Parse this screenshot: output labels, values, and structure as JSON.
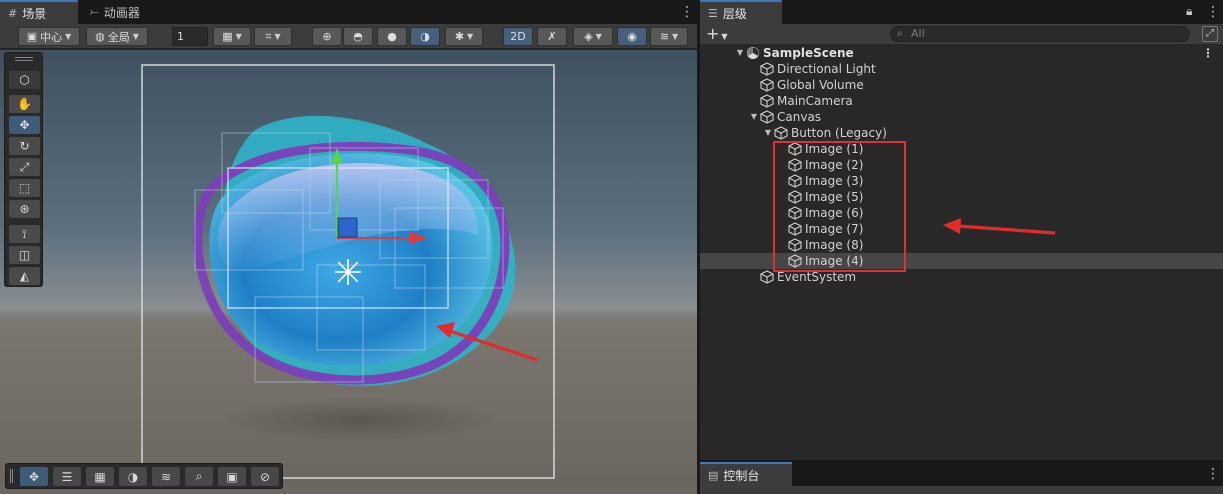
{
  "scene_panel": {
    "tabs": [
      {
        "label": "场景",
        "icon": "grid-icon"
      },
      {
        "label": "动画器",
        "icon": "animator-icon"
      }
    ],
    "toolbar": {
      "pivot_label": "中心",
      "space_label": "全局",
      "snap_value": "1",
      "mode_2d_label": "2D"
    }
  },
  "hierarchy": {
    "tab_label": "层级",
    "search_placeholder": "All",
    "add_label": "+",
    "items": [
      {
        "label": "SampleScene",
        "depth": 0,
        "expanded": true,
        "type": "scene"
      },
      {
        "label": "Directional Light",
        "depth": 1,
        "type": "object"
      },
      {
        "label": "Global Volume",
        "depth": 1,
        "type": "object"
      },
      {
        "label": "MainCamera",
        "depth": 1,
        "type": "object"
      },
      {
        "label": "Canvas",
        "depth": 1,
        "expanded": true,
        "type": "object"
      },
      {
        "label": "Button (Legacy)",
        "depth": 2,
        "expanded": true,
        "type": "object"
      },
      {
        "label": "Image (1)",
        "depth": 3,
        "type": "object"
      },
      {
        "label": "Image (2)",
        "depth": 3,
        "type": "object"
      },
      {
        "label": "Image (3)",
        "depth": 3,
        "type": "object"
      },
      {
        "label": "Image (5)",
        "depth": 3,
        "type": "object"
      },
      {
        "label": "Image (6)",
        "depth": 3,
        "type": "object"
      },
      {
        "label": "Image (7)",
        "depth": 3,
        "type": "object"
      },
      {
        "label": "Image (8)",
        "depth": 3,
        "type": "object"
      },
      {
        "label": "Image (4)",
        "depth": 3,
        "type": "object",
        "selected": true
      },
      {
        "label": "EventSystem",
        "depth": 1,
        "type": "object"
      }
    ]
  },
  "console": {
    "tab_label": "控制台"
  },
  "colors": {
    "accent": "#3a79bb",
    "annotation_red": "#e32b2b",
    "selection_box": "#e03030"
  }
}
